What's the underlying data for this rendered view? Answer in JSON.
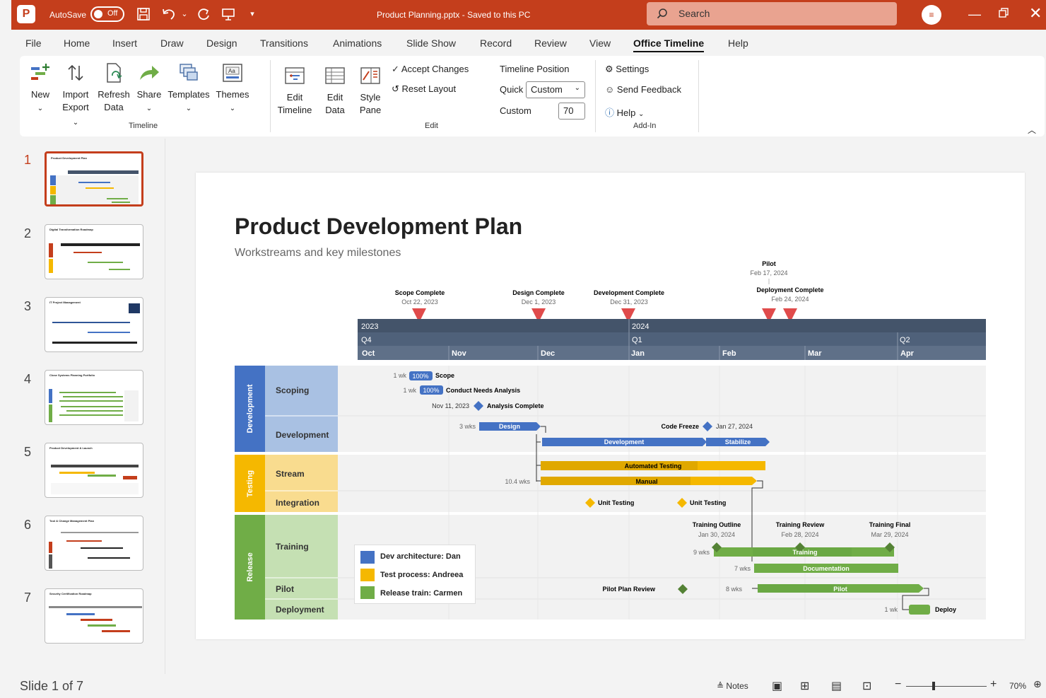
{
  "titlebar": {
    "app_letter": "P",
    "autosave_label": "AutoSave",
    "autosave_state": "Off",
    "document_title": "Product Planning.pptx - Saved to this PC",
    "search_placeholder": "Search",
    "accent": "#c43e1c"
  },
  "tabs": [
    "File",
    "Home",
    "Insert",
    "Draw",
    "Design",
    "Transitions",
    "Animations",
    "Slide Show",
    "Record",
    "Review",
    "View",
    "Office Timeline",
    "Help"
  ],
  "active_tab": "Office Timeline",
  "ribbon": {
    "timeline_group": {
      "label": "Timeline",
      "new": "New",
      "import": "Import",
      "export": "Export",
      "refresh": "Refresh",
      "refresh2": "Data",
      "share": "Share",
      "templates": "Templates",
      "themes": "Themes"
    },
    "edit_group": {
      "label": "Edit",
      "edit_timeline_1": "Edit",
      "edit_timeline_2": "Timeline",
      "edit_data_1": "Edit",
      "edit_data_2": "Data",
      "style_pane_1": "Style",
      "style_pane_2": "Pane",
      "accept_changes": "Accept Changes",
      "reset_layout": "Reset Layout",
      "timeline_position": "Timeline Position",
      "quick_label": "Quick",
      "quick_value": "Custom",
      "custom_label": "Custom",
      "custom_value": "70"
    },
    "addin_group": {
      "label": "Add-In",
      "settings": "Settings",
      "send_feedback": "Send Feedback",
      "help": "Help"
    }
  },
  "slides": [
    {
      "num": "1",
      "title": "Product Development Plan"
    },
    {
      "num": "2",
      "title": "Digital Transformation Roadmap"
    },
    {
      "num": "3",
      "title": "IT Project Management"
    },
    {
      "num": "4",
      "title": "Close Systems Planning Portfolio"
    },
    {
      "num": "5",
      "title": "Product Development & Launch"
    },
    {
      "num": "6",
      "title": "Tool & Change Management Plan"
    },
    {
      "num": "7",
      "title": "Security Certification Roadmap"
    }
  ],
  "slide": {
    "title": "Product Development Plan",
    "subtitle": "Workstreams and key milestones",
    "top_milestones": [
      {
        "name": "Scope Complete",
        "date": "Oct 22, 2023"
      },
      {
        "name": "Design Complete",
        "date": "Dec 1, 2023"
      },
      {
        "name": "Development Complete",
        "date": "Dec 31, 2023"
      },
      {
        "name": "Pilot",
        "date": "Feb 17, 2024"
      },
      {
        "name": "Deployment Complete",
        "date": "Feb 24, 2024"
      }
    ],
    "years": [
      "2023",
      "2024"
    ],
    "quarters": [
      "Q4",
      "Q1",
      "Q2"
    ],
    "months": [
      "Oct",
      "Nov",
      "Dec",
      "Jan",
      "Feb",
      "Mar",
      "Apr"
    ],
    "swimlanes": [
      {
        "name": "Development",
        "color": "#4472c4",
        "light": "#a9c1e3",
        "rows": [
          "Scoping",
          "Development"
        ]
      },
      {
        "name": "Testing",
        "color": "#f5b800",
        "light": "#f9dc8f",
        "rows": [
          "Stream",
          "Integration"
        ]
      },
      {
        "name": "Release",
        "color": "#70ad47",
        "light": "#c5e0b3",
        "rows": [
          "Training",
          "Pilot",
          "Deployment"
        ]
      }
    ],
    "tasks": {
      "scope_dur": "1 wk",
      "scope_pct": "100%",
      "scope_name": "Scope",
      "cna_dur": "1 wk",
      "cna_pct": "100%",
      "cna_name": "Conduct Needs Analysis",
      "ac_date": "Nov 11, 2023",
      "ac_name": "Analysis Complete",
      "design_dur": "3 wks",
      "design_name": "Design",
      "cf_name": "Code Freeze",
      "cf_date": "Jan 27, 2024",
      "development_name": "Development",
      "stabilize_name": "Stabilize",
      "auto_name": "Automated Testing",
      "manual_dur": "10.4 wks",
      "manual_name": "Manual",
      "ut1": "Unit Testing",
      "ut2": "Unit Testing",
      "to_name": "Training Outline",
      "to_date": "Jan 30, 2024",
      "tr_name": "Training Review",
      "tr_date": "Feb 28, 2024",
      "tf_name": "Training Final",
      "tf_date": "Mar 29, 2024",
      "training_dur": "9 wks",
      "training_name": "Training",
      "doc_dur": "7 wks",
      "doc_name": "Documentation",
      "ppr_name": "Pilot Plan Review",
      "pilot_dur": "8 wks",
      "pilot_name": "Pilot",
      "deploy_dur": "1 wk",
      "deploy_name": "Deploy"
    },
    "legend": [
      {
        "label": "Dev architecture: Dan",
        "color": "#4472c4"
      },
      {
        "label": "Test process: Andreea",
        "color": "#f5b800"
      },
      {
        "label": "Release train: Carmen",
        "color": "#70ad47"
      }
    ]
  },
  "statusbar": {
    "slide_info": "Slide 1 of 7",
    "notes": "Notes",
    "zoom": "70%"
  }
}
